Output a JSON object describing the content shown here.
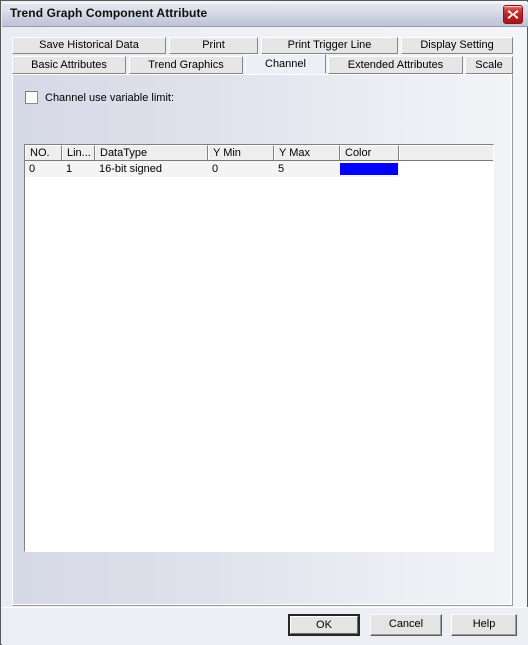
{
  "window": {
    "title": "Trend Graph Component Attribute",
    "close_icon": "close-icon"
  },
  "tabs": {
    "row1": [
      {
        "label": "Save Historical Data",
        "active": false
      },
      {
        "label": "Print",
        "active": false
      },
      {
        "label": "Print Trigger Line",
        "active": false
      },
      {
        "label": "Display Setting",
        "active": false
      }
    ],
    "row2": [
      {
        "label": "Basic Attributes",
        "active": false
      },
      {
        "label": "Trend Graphics",
        "active": false
      },
      {
        "label": "Channel",
        "active": true
      },
      {
        "label": "Extended Attributes",
        "active": false
      },
      {
        "label": "Scale",
        "active": false
      }
    ]
  },
  "panel": {
    "checkbox": {
      "label": "Channel use variable limit:",
      "checked": false
    },
    "table": {
      "columns": [
        "NO.",
        "Lin...",
        "DataType",
        "Y Min",
        "Y Max",
        "Color",
        ""
      ],
      "rows": [
        {
          "no": "0",
          "line": "1",
          "datatype": "16-bit signed",
          "ymin": "0",
          "ymax": "5",
          "color": "#0000FF",
          "extra": ""
        }
      ]
    }
  },
  "buttons": {
    "ok": "OK",
    "cancel": "Cancel",
    "help": "Help"
  }
}
